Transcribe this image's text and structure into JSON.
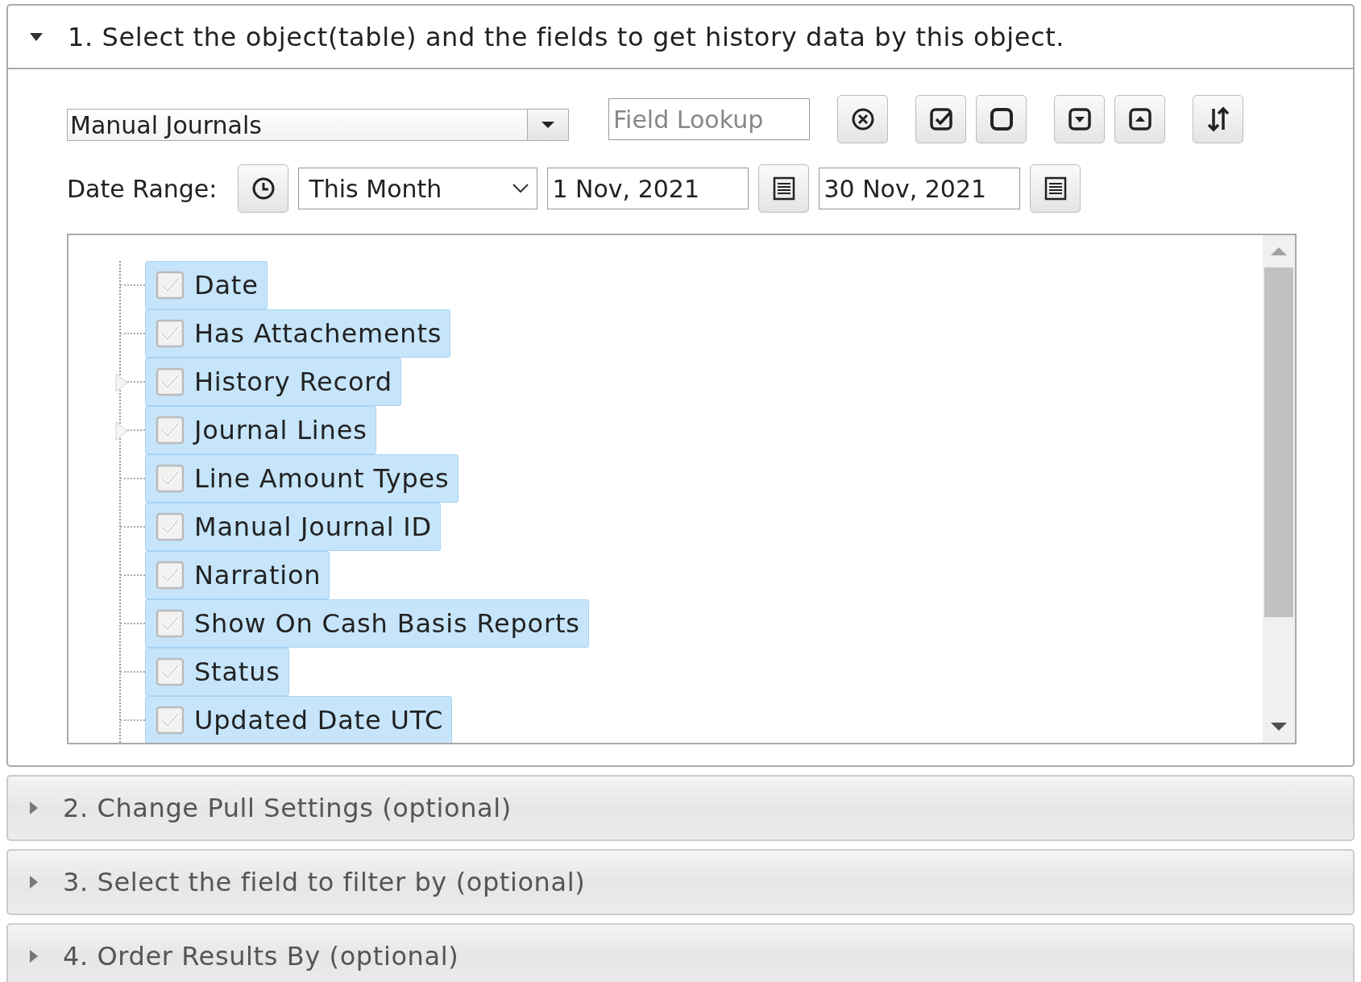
{
  "sections": [
    {
      "title": "1. Select the object(table) and the fields to get history data by this object.",
      "expanded": true
    },
    {
      "title": "2. Change Pull Settings (optional)",
      "expanded": false
    },
    {
      "title": "3. Select the field to filter by (optional)",
      "expanded": false
    },
    {
      "title": "4. Order Results By (optional)",
      "expanded": false
    }
  ],
  "object_select": {
    "value": "Manual Journals"
  },
  "field_lookup": {
    "placeholder": "Field Lookup"
  },
  "date_range": {
    "label": "Date Range:",
    "preset": "This Month",
    "start": "1 Nov, 2021",
    "end": "30 Nov, 2021"
  },
  "fields": [
    {
      "label": "Date",
      "kind": "field",
      "checked": true,
      "selected": true
    },
    {
      "label": "Has Attachements",
      "kind": "field",
      "checked": true,
      "selected": true
    },
    {
      "label": "History Record",
      "kind": "group",
      "expanded": false,
      "checked": true,
      "selected": true
    },
    {
      "label": "Journal Lines",
      "kind": "group",
      "expanded": false,
      "checked": true,
      "selected": true
    },
    {
      "label": "Line Amount Types",
      "kind": "field",
      "checked": true,
      "selected": true
    },
    {
      "label": "Manual Journal ID",
      "kind": "field",
      "checked": true,
      "selected": true
    },
    {
      "label": "Narration",
      "kind": "field",
      "checked": true,
      "selected": true
    },
    {
      "label": "Show On Cash Basis Reports",
      "kind": "field",
      "checked": true,
      "selected": true
    },
    {
      "label": "Status",
      "kind": "field",
      "checked": true,
      "selected": true
    },
    {
      "label": "Updated Date UTC",
      "kind": "field",
      "checked": true,
      "selected": true
    }
  ]
}
